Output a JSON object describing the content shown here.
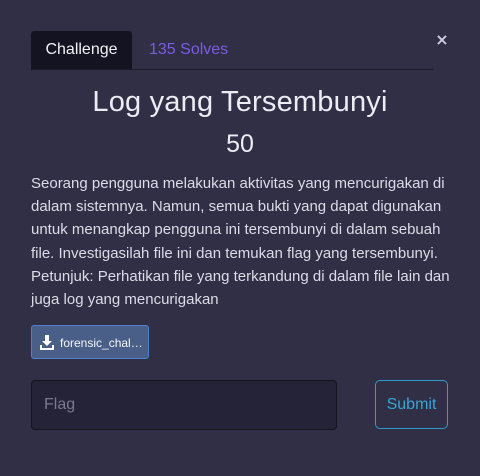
{
  "modal": {
    "close_label": "×"
  },
  "tabs": [
    {
      "label": "Challenge",
      "active": true
    },
    {
      "label": "135 Solves",
      "active": false
    }
  ],
  "challenge": {
    "title": "Log yang Tersembunyi",
    "points": "50",
    "description": "Seorang pengguna melakukan aktivitas yang mencurigakan di dalam sistemnya. Namun, semua bukti yang dapat digunakan untuk menangkap pengguna ini tersembunyi di dalam sebuah file. Investigasilah file ini dan temukan flag yang tersembunyi. Petunjuk: Perhatikan file yang terkandung di dalam file lain dan juga log yang mencurigakan"
  },
  "file": {
    "name": "forensic_challenge",
    "icon": "download-icon"
  },
  "flag_form": {
    "placeholder": "Flag",
    "value": "",
    "submit_label": "Submit"
  },
  "colors": {
    "background": "#312f46",
    "active_tab": "#141321",
    "solves_link": "#7b5ce6",
    "file_button": "#4a5f87",
    "submit_accent": "#38a6d6"
  }
}
